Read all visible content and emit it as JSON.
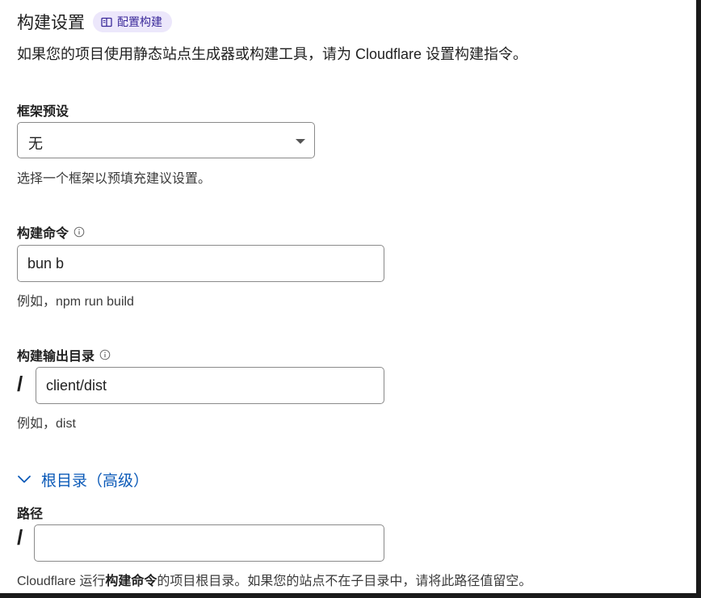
{
  "header": {
    "title": "构建设置",
    "docs_link": "配置构建",
    "description": "如果您的项目使用静态站点生成器或构建工具，请为 Cloudflare 设置构建指令。"
  },
  "framework": {
    "label": "框架预设",
    "selected": "无",
    "help": "选择一个框架以预填充建议设置。"
  },
  "build_command": {
    "label": "构建命令",
    "value": "bun b",
    "help": "例如，npm run build"
  },
  "output_dir": {
    "label": "构建输出目录",
    "prefix": "/",
    "value": "client/dist",
    "help": "例如，dist"
  },
  "root": {
    "toggle_label": "根目录（高级）",
    "path_label": "路径",
    "prefix": "/",
    "value": "",
    "help_prefix": "Cloudflare 运行",
    "help_bold": "构建命令",
    "help_suffix": "的项目根目录。如果您的站点不在子目录中，请将此路径值留空。"
  },
  "colors": {
    "accent": "#0b5ab8",
    "badge_bg": "#ece7fb",
    "badge_text": "#3b2a9a"
  },
  "icons": {
    "docs": "book-icon",
    "info": "info-icon",
    "disclosure": "chevron-down-icon",
    "select": "caret-down-icon"
  }
}
